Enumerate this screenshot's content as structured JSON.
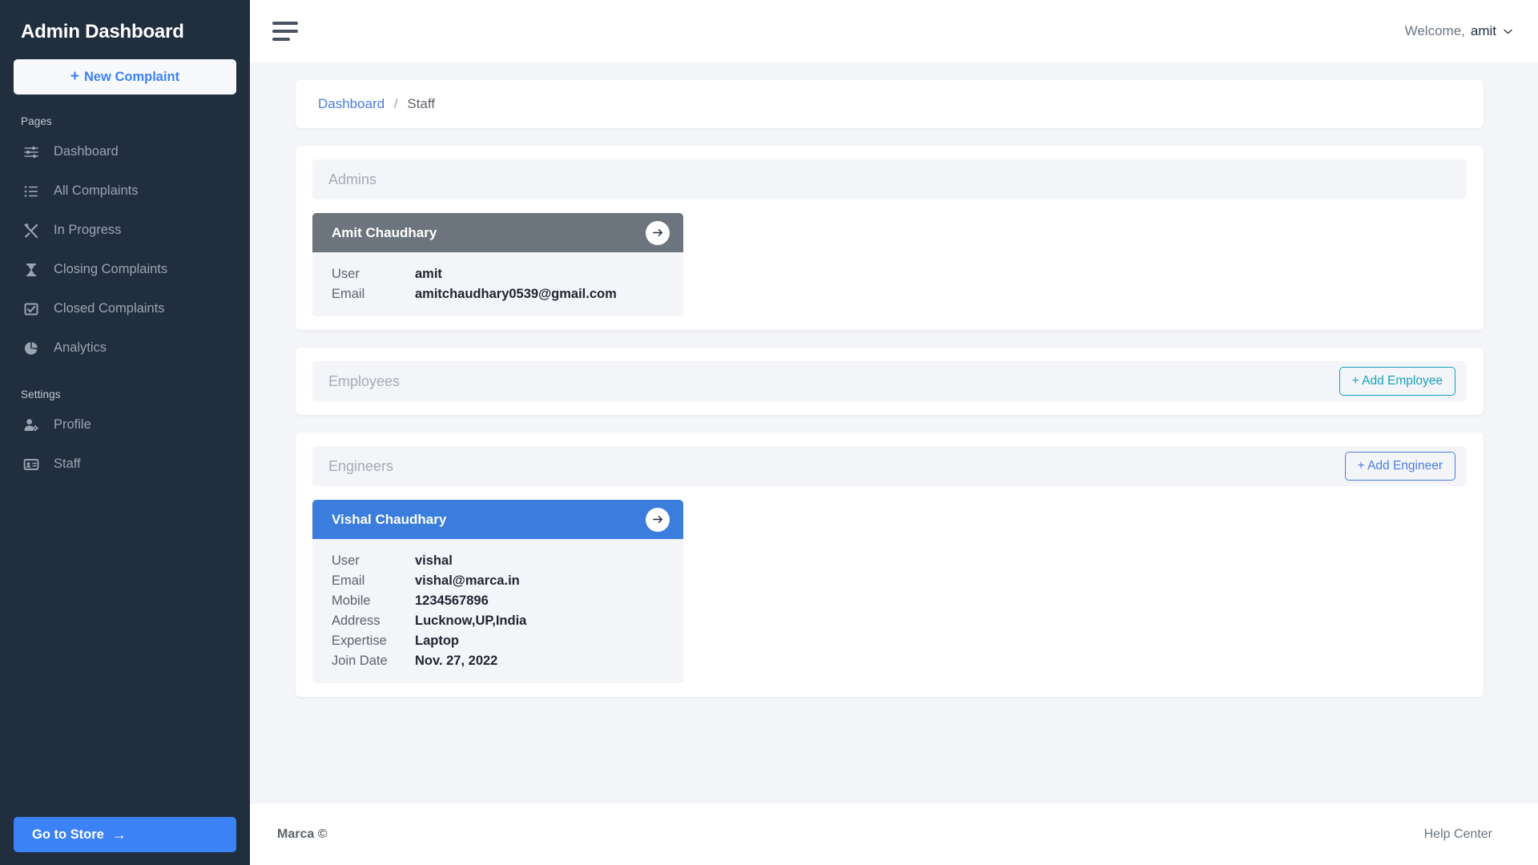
{
  "sidebar": {
    "brand": "Admin Dashboard",
    "new_complaint_label": "New Complaint",
    "new_complaint_plus": "+",
    "pages_label": "Pages",
    "settings_label": "Settings",
    "pages_items": [
      {
        "label": "Dashboard",
        "icon": "sliders-icon"
      },
      {
        "label": "All Complaints",
        "icon": "list-icon"
      },
      {
        "label": "In Progress",
        "icon": "tools-icon"
      },
      {
        "label": "Closing Complaints",
        "icon": "hourglass-icon"
      },
      {
        "label": "Closed Complaints",
        "icon": "checkbox-checked-icon"
      },
      {
        "label": "Analytics",
        "icon": "pie-chart-icon"
      }
    ],
    "settings_items": [
      {
        "label": "Profile",
        "icon": "user-gear-icon"
      },
      {
        "label": "Staff",
        "icon": "id-card-icon"
      }
    ],
    "store_button": {
      "label": "Go to Store",
      "arrow": "→"
    }
  },
  "topbar": {
    "menu_icon": "hamburger-icon",
    "welcome_text": "Welcome,",
    "user_name": "amit",
    "chevron": "⌄"
  },
  "breadcrumb": {
    "link": "Dashboard",
    "separator": "/",
    "current": "Staff"
  },
  "sections": {
    "admins": {
      "title": "Admins",
      "person": {
        "name": "Amit Chaudhary",
        "header_color": "#6c757d",
        "fields": [
          {
            "label": "User",
            "value": "amit"
          },
          {
            "label": "Email",
            "value": "amitchaudhary0539@gmail.com"
          }
        ]
      }
    },
    "employees": {
      "title": "Employees",
      "add_button": "+ Add Employee",
      "add_button_color": "#17a2b8",
      "people": []
    },
    "engineers": {
      "title": "Engineers",
      "add_button": "+ Add Engineer",
      "add_button_color": "#4a7dde",
      "person": {
        "name": "Vishal Chaudhary",
        "header_color": "#3b7ddd",
        "fields": [
          {
            "label": "User",
            "value": "vishal"
          },
          {
            "label": "Email",
            "value": "vishal@marca.in"
          },
          {
            "label": "Mobile",
            "value": "1234567896"
          },
          {
            "label": "Address",
            "value": "Lucknow,UP,India"
          },
          {
            "label": "Expertise",
            "value": "Laptop"
          },
          {
            "label": "Join Date",
            "value": "Nov. 27, 2022"
          }
        ]
      }
    }
  },
  "footer": {
    "copyright": "Marca ©",
    "help_link": "Help Center"
  },
  "theme": {
    "sidebar_bg": "#212e3e",
    "accent_blue": "#3b82f6",
    "accent_teal": "#17a2b8",
    "page_bg": "#f4f5f9"
  }
}
